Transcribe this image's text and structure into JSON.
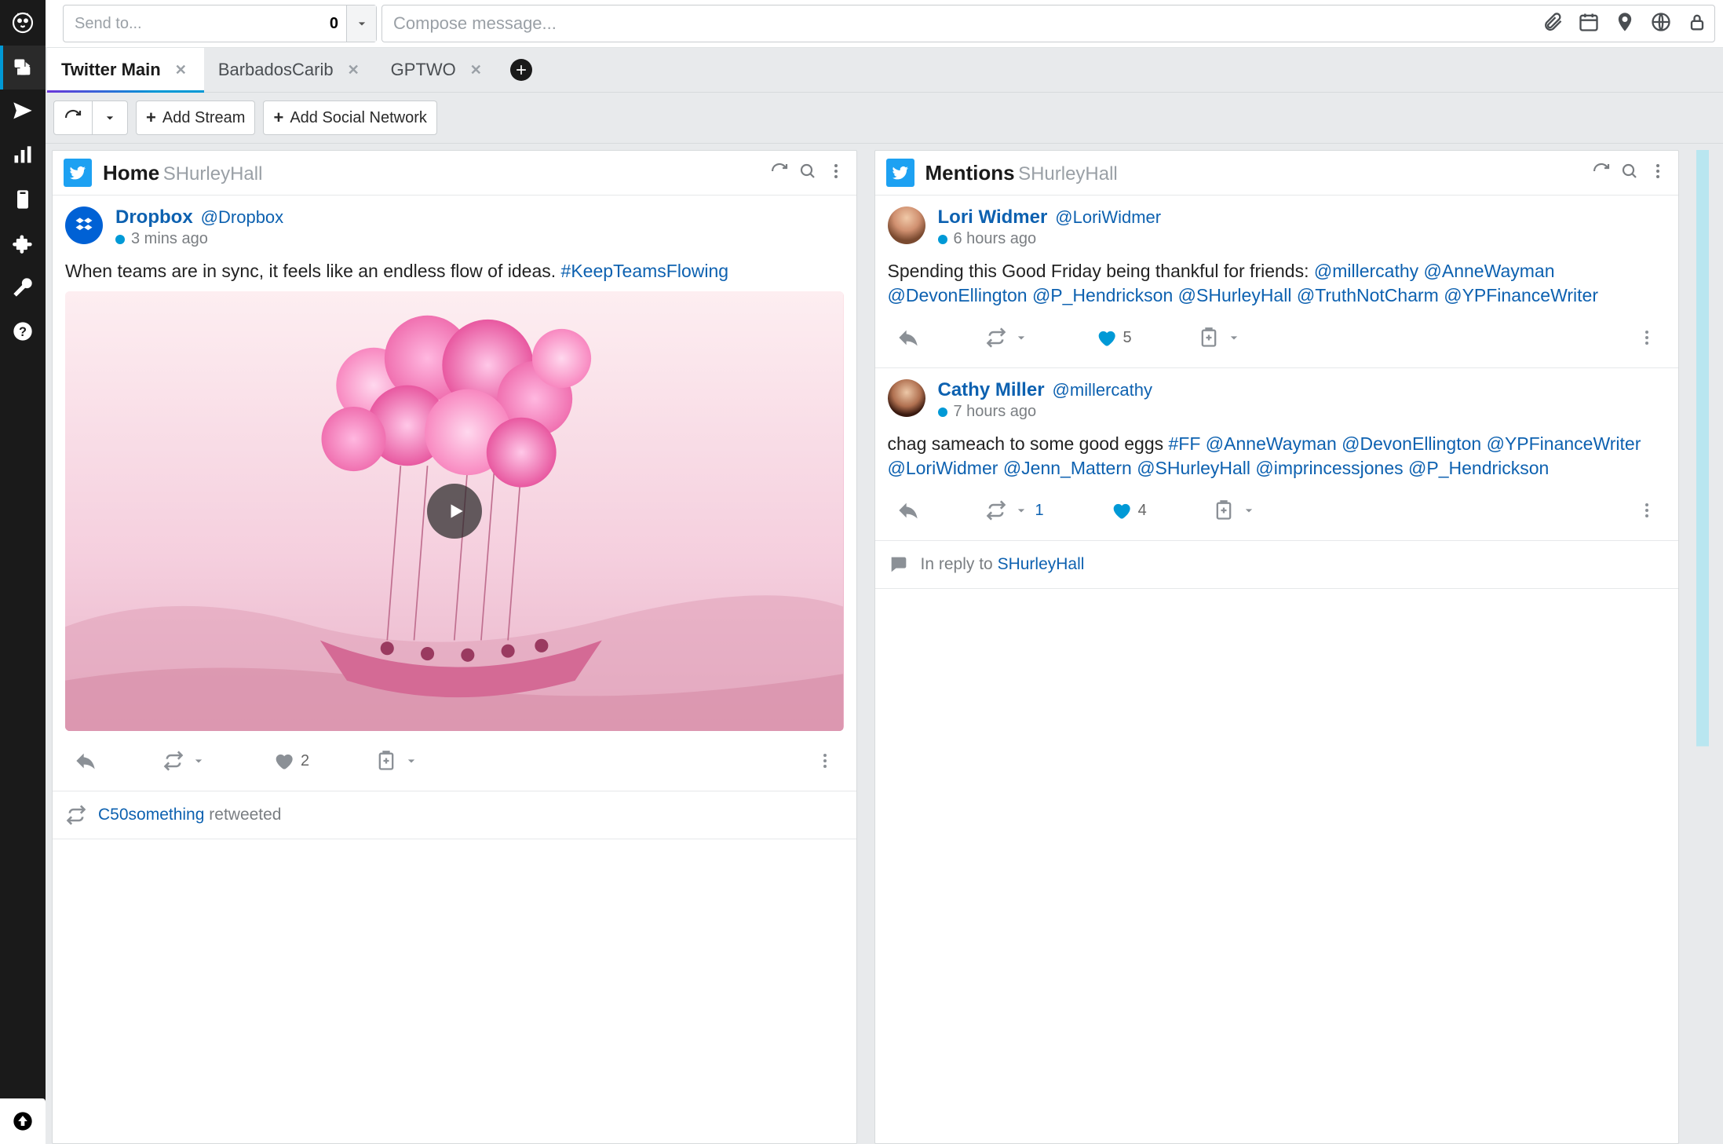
{
  "compose": {
    "send_to_placeholder": "Send to...",
    "send_to_count": "0",
    "message_placeholder": "Compose message..."
  },
  "tabs": [
    {
      "label": "Twitter Main",
      "active": true
    },
    {
      "label": "BarbadosCarib",
      "active": false
    },
    {
      "label": "GPTWO",
      "active": false
    }
  ],
  "toolbar": {
    "add_stream_label": "Add Stream",
    "add_network_label": "Add Social Network"
  },
  "streams": [
    {
      "title": "Home",
      "account": "SHurleyHall",
      "posts": [
        {
          "name": "Dropbox",
          "handle": "@Dropbox",
          "time": "3 mins ago",
          "body_pre": "When teams are in sync, it feels like an endless flow of ideas. ",
          "body_links": [
            "#KeepTeamsFlowing"
          ],
          "like_count": "2",
          "has_media": true
        }
      ],
      "retweet_row": {
        "user": "C50something",
        "label": "retweeted"
      }
    },
    {
      "title": "Mentions",
      "account": "SHurleyHall",
      "posts": [
        {
          "name": "Lori Widmer",
          "handle": "@LoriWidmer",
          "time": "6 hours ago",
          "body_pre": "Spending this Good Friday being thankful for friends: ",
          "body_links": [
            "@millercathy",
            "@AnneWayman",
            "@DevonEllington",
            "@P_Hendrickson",
            "@SHurleyHall",
            "@TruthNotCharm",
            "@YPFinanceWriter"
          ],
          "like_count": "5",
          "liked": true
        },
        {
          "name": "Cathy Miller",
          "handle": "@millercathy",
          "time": "7 hours ago",
          "body_pre": "chag sameach to some good eggs ",
          "body_links": [
            "#FF",
            "@AnneWayman",
            "@DevonEllington",
            "@YPFinanceWriter",
            "@LoriWidmer",
            "@Jenn_Mattern",
            "@SHurleyHall",
            "@imprincessjones",
            "@P_Hendrickson"
          ],
          "like_count": "4",
          "rt_count": "1",
          "liked": true
        }
      ],
      "reply_row": {
        "prefix": "In reply to ",
        "user": "SHurleyHall"
      }
    }
  ]
}
